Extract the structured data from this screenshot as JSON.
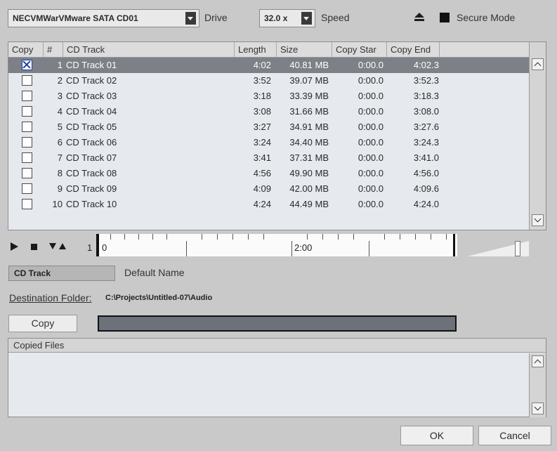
{
  "top": {
    "drive_value": "NECVMWarVMware SATA CD01",
    "drive_label": "Drive",
    "speed_value": "32.0 x",
    "speed_label": "Speed",
    "secure_mode_label": "Secure Mode"
  },
  "table": {
    "columns": [
      "Copy",
      "#",
      "CD Track",
      "Length",
      "Size",
      "Copy Star",
      "Copy End"
    ],
    "rows": [
      {
        "checked": true,
        "num": "1",
        "name": "CD Track 01",
        "length": "4:02",
        "size": "40.81 MB",
        "copy_start": "0:00.0",
        "copy_end": "4:02.3"
      },
      {
        "checked": false,
        "num": "2",
        "name": "CD Track 02",
        "length": "3:52",
        "size": "39.07 MB",
        "copy_start": "0:00.0",
        "copy_end": "3:52.3"
      },
      {
        "checked": false,
        "num": "3",
        "name": "CD Track 03",
        "length": "3:18",
        "size": "33.39 MB",
        "copy_start": "0:00.0",
        "copy_end": "3:18.3"
      },
      {
        "checked": false,
        "num": "4",
        "name": "CD Track 04",
        "length": "3:08",
        "size": "31.66 MB",
        "copy_start": "0:00.0",
        "copy_end": "3:08.0"
      },
      {
        "checked": false,
        "num": "5",
        "name": "CD Track 05",
        "length": "3:27",
        "size": "34.91 MB",
        "copy_start": "0:00.0",
        "copy_end": "3:27.6"
      },
      {
        "checked": false,
        "num": "6",
        "name": "CD Track 06",
        "length": "3:24",
        "size": "34.40 MB",
        "copy_start": "0:00.0",
        "copy_end": "3:24.3"
      },
      {
        "checked": false,
        "num": "7",
        "name": "CD Track 07",
        "length": "3:41",
        "size": "37.31 MB",
        "copy_start": "0:00.0",
        "copy_end": "3:41.0"
      },
      {
        "checked": false,
        "num": "8",
        "name": "CD Track 08",
        "length": "4:56",
        "size": "49.90 MB",
        "copy_start": "0:00.0",
        "copy_end": "4:56.0"
      },
      {
        "checked": false,
        "num": "9",
        "name": "CD Track 09",
        "length": "4:09",
        "size": "42.00 MB",
        "copy_start": "0:00.0",
        "copy_end": "4:09.6"
      },
      {
        "checked": false,
        "num": "10",
        "name": "CD Track 10",
        "length": "4:24",
        "size": "44.49 MB",
        "copy_start": "0:00.0",
        "copy_end": "4:24.0"
      }
    ]
  },
  "ruler": {
    "start_label": "1",
    "start_tick_label": "0",
    "mid_label": "2:00"
  },
  "name_row": {
    "field_value": "CD Track",
    "option_label": "Default Name"
  },
  "destination": {
    "label": "Destination Folder:",
    "path": "C:\\Projects\\Untitled-07\\Audio"
  },
  "copy_button_label": "Copy",
  "copied_files_header": "Copied Files",
  "buttons": {
    "ok": "OK",
    "cancel": "Cancel"
  },
  "colors": {
    "dialog_bg": "#c9c9c9",
    "list_bg": "#e6e9ed",
    "selected_row": "#7d8087",
    "progress_fill": "#6c717a",
    "checkbox_mark": "#1f3fa8"
  },
  "icons": [
    "eject-icon",
    "secure-mode-checkbox",
    "play-icon",
    "stop-icon",
    "down-triangle-icon",
    "up-triangle-icon",
    "chevron-up-icon",
    "chevron-down-icon",
    "combo-arrow-icon"
  ]
}
